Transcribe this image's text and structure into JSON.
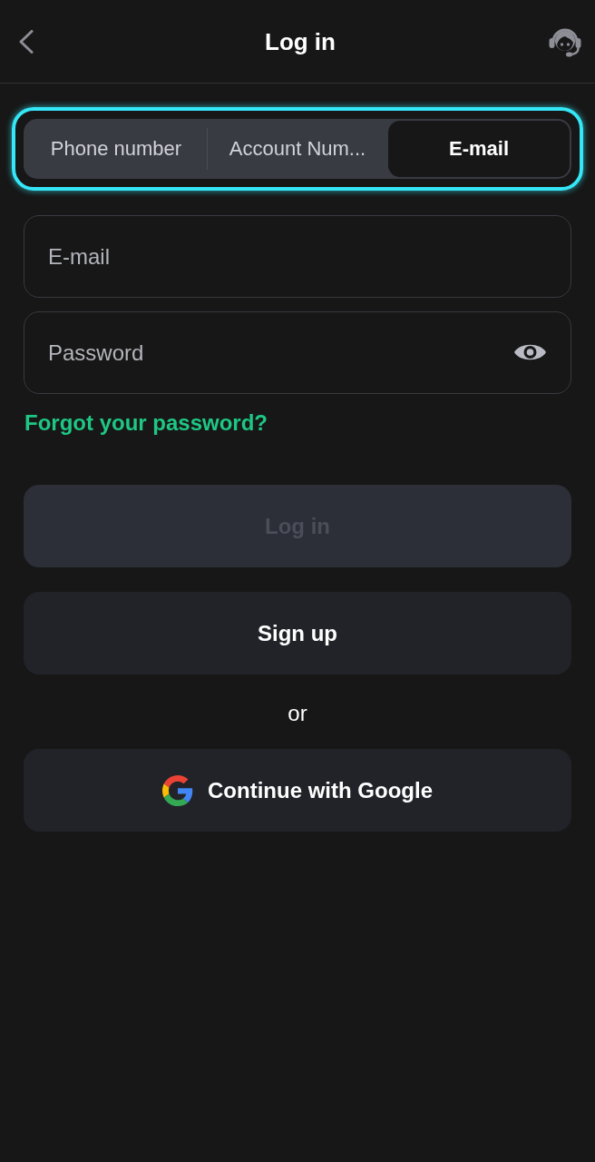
{
  "header": {
    "title": "Log in"
  },
  "tabs": {
    "highlighted": true,
    "items": [
      {
        "label": "Phone number",
        "selected": false
      },
      {
        "label": "Account Num...",
        "selected": false
      },
      {
        "label": "E-mail",
        "selected": true
      }
    ]
  },
  "fields": [
    {
      "kind": "email",
      "placeholder": "E-mail"
    },
    {
      "kind": "password",
      "placeholder": "Password"
    }
  ],
  "forgot_link": "Forgot your password?",
  "buttons": [
    {
      "label": "Log in",
      "disabled": true
    },
    {
      "label": "Sign up",
      "disabled": false
    }
  ],
  "separator": "or",
  "social_button": {
    "label": "Continue with Google"
  }
}
